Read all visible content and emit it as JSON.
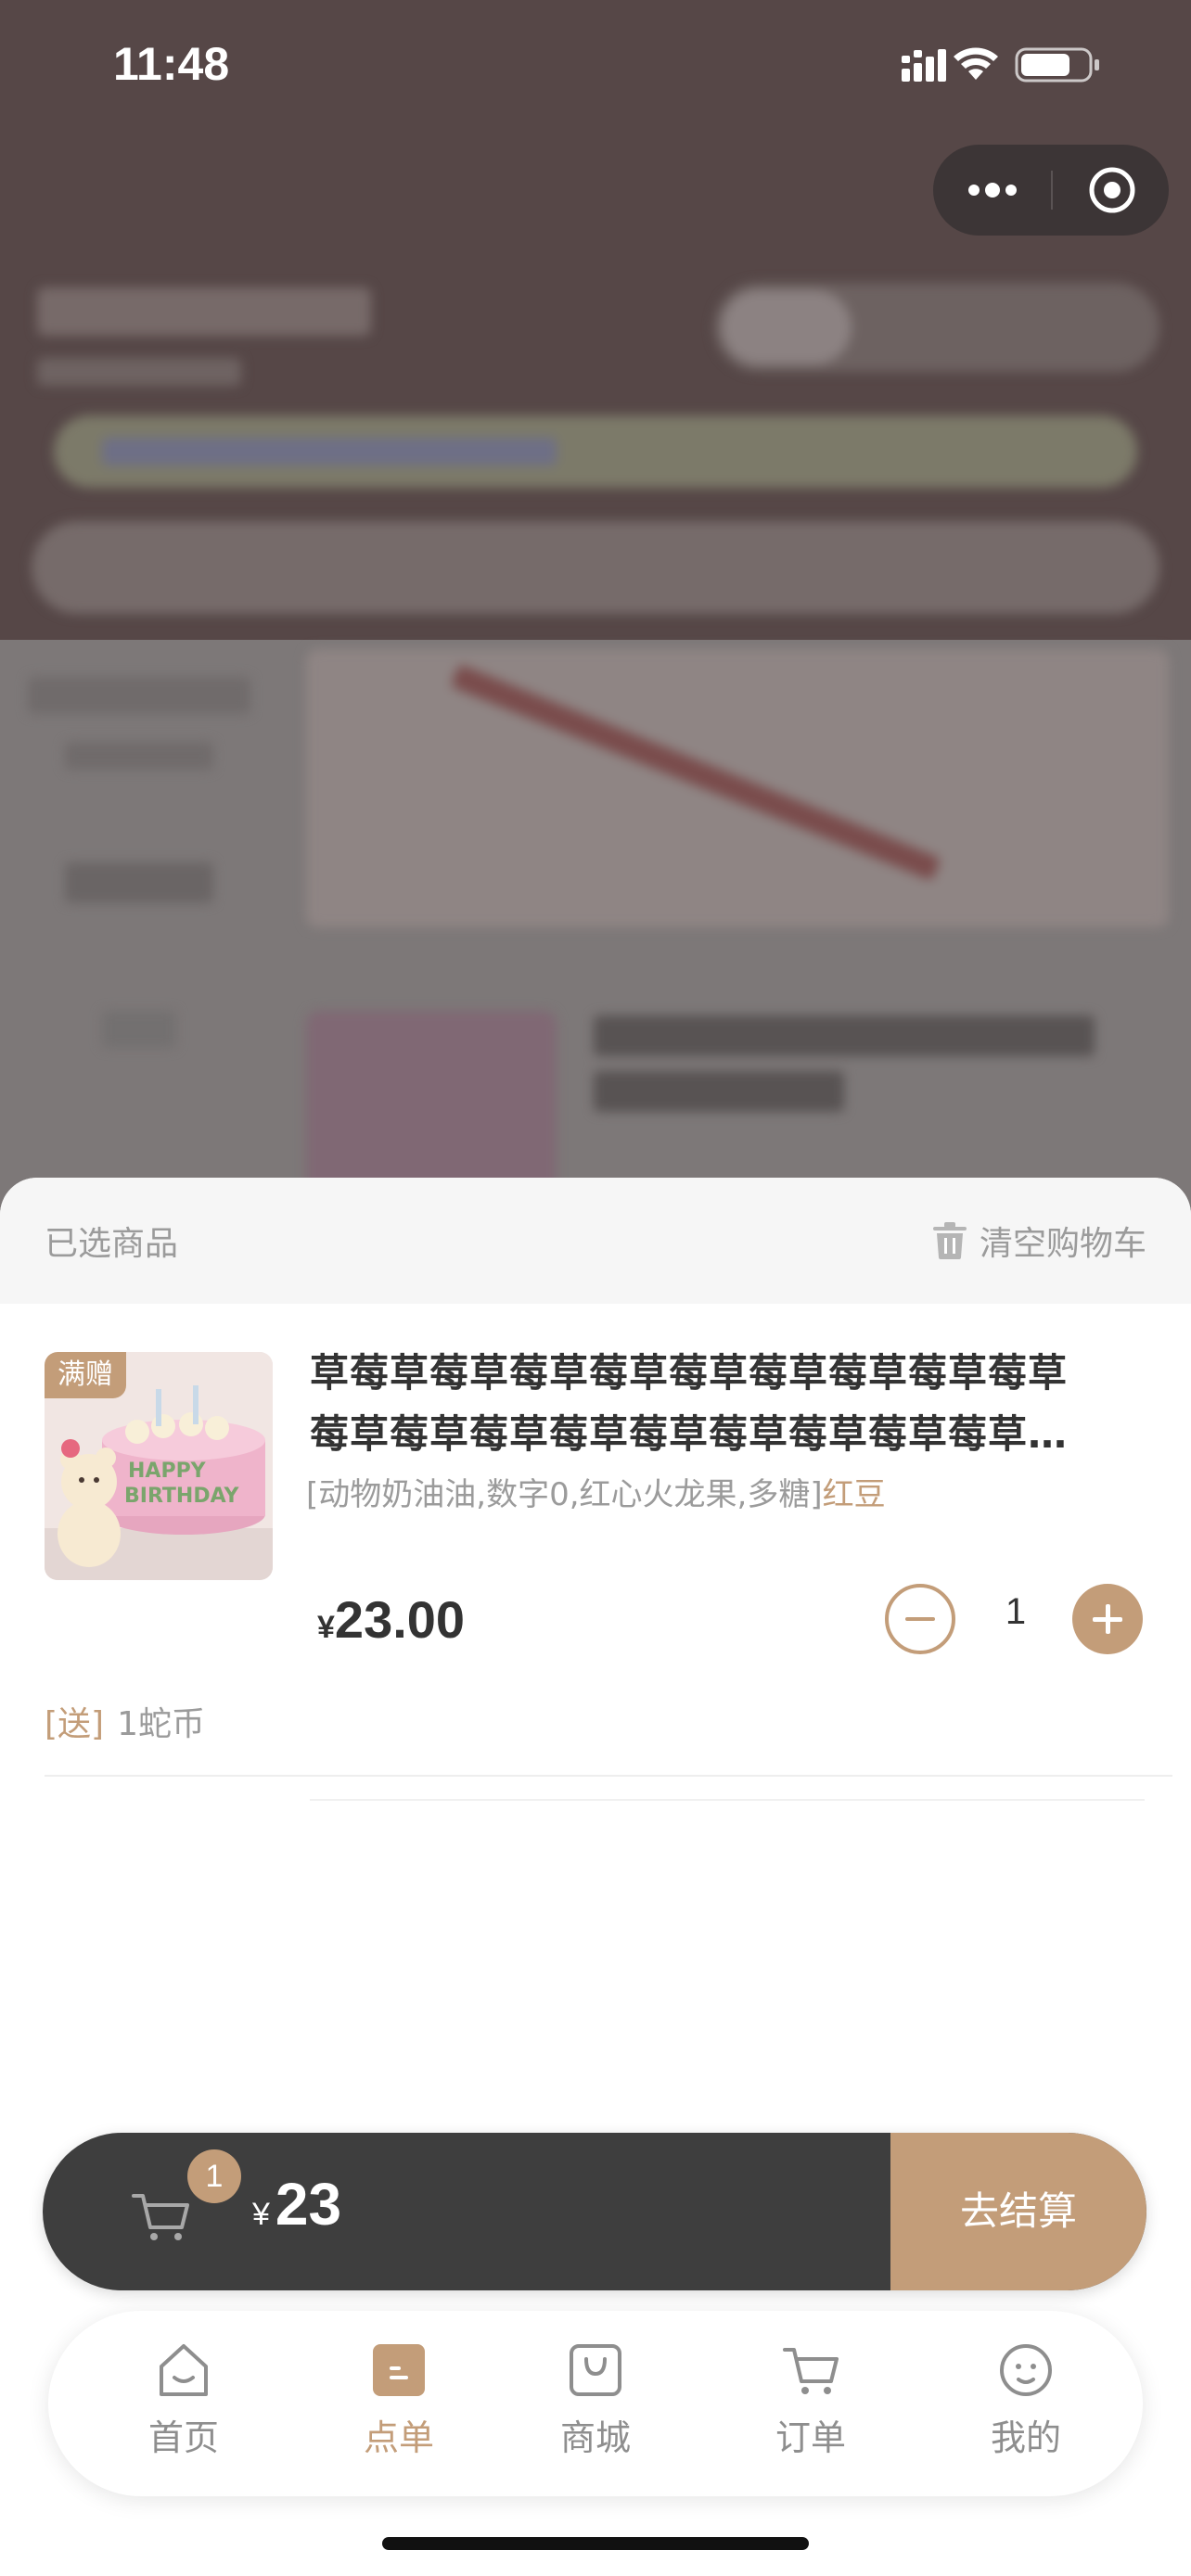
{
  "status_bar": {
    "time": "11:48"
  },
  "sheet": {
    "title": "已选商品",
    "clear_label": "清空购物车"
  },
  "cart_item": {
    "tag": "满赠",
    "name_line1": "草莓草莓草莓草莓草莓草莓草莓草莓草莓草",
    "name_line2": "莓草莓草莓草莓草莓草莓草莓草莓草莓草…",
    "spec": "[动物奶油油,数字0,红心火龙果,多糖]",
    "spec_highlight": "红豆",
    "price_currency": "¥",
    "price": "23.00",
    "quantity": "1"
  },
  "gift": {
    "tag": "[送]",
    "text": "1蛇币"
  },
  "checkout": {
    "badge_count": "1",
    "currency": "¥",
    "total": "23",
    "button_label": "去结算"
  },
  "tabbar": {
    "items": [
      {
        "label": "首页",
        "icon": "home-icon"
      },
      {
        "label": "点单",
        "icon": "order-menu-icon"
      },
      {
        "label": "商城",
        "icon": "shop-bag-icon"
      },
      {
        "label": "订单",
        "icon": "cart-icon"
      },
      {
        "label": "我的",
        "icon": "profile-icon"
      }
    ],
    "active_index": 1
  },
  "colors": {
    "accent": "#c39d79",
    "checkout_bar": "#3e3e3e",
    "overlay_header": "#564747"
  }
}
